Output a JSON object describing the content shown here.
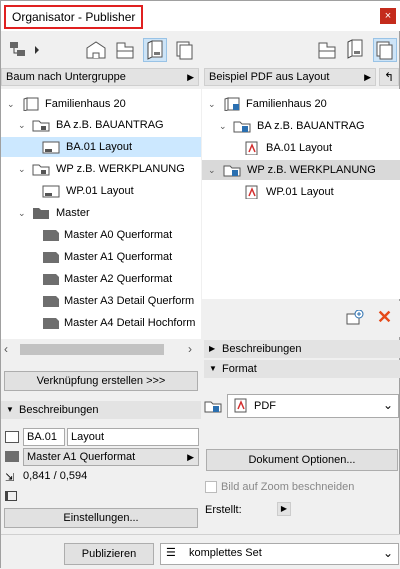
{
  "window": {
    "title": "Organisator - Publisher",
    "close": "×"
  },
  "left": {
    "header": "Baum nach Untergruppe",
    "tree": [
      {
        "label": "Familienhaus 20"
      },
      {
        "label": "BA z.B. BAUANTRAG"
      },
      {
        "label": "BA.01 Layout"
      },
      {
        "label": "WP z.B. WERKPLANUNG"
      },
      {
        "label": "WP.01 Layout"
      },
      {
        "label": "Master"
      },
      {
        "label": "Master A0 Querformat"
      },
      {
        "label": "Master A1 Querformat"
      },
      {
        "label": "Master A2 Querformat"
      },
      {
        "label": "Master A3 Detail Querform"
      },
      {
        "label": "Master A4 Detail Hochform"
      }
    ],
    "connect_button": "Verknüpfung erstellen >>>",
    "descriptions": "Beschreibungen",
    "id_value": "BA.01",
    "name_value": "Layout",
    "master_value": "Master A1 Querformat",
    "size_value": "0,841 / 0,594",
    "settings_button": "Einstellungen..."
  },
  "right": {
    "header": "Beispiel PDF aus Layout",
    "tree": [
      {
        "label": "Familienhaus 20"
      },
      {
        "label": "BA z.B. BAUANTRAG"
      },
      {
        "label": "BA.01 Layout"
      },
      {
        "label": "WP z.B. WERKPLANUNG"
      },
      {
        "label": "WP.01 Layout"
      }
    ],
    "descriptions": "Beschreibungen",
    "format_label": "Format",
    "format_value": "PDF",
    "doc_options_button": "Dokument Optionen...",
    "zoom_checkbox": "Bild auf Zoom beschneiden",
    "created_label": "Erstellt:"
  },
  "bottom": {
    "publish_button": "Publizieren",
    "set_value": "komplettes Set"
  },
  "colors": {
    "selection": "#cce8ff",
    "highlight_box": "#e02020",
    "close_bg": "#c42b1c",
    "delete_x": "#e64a19"
  }
}
